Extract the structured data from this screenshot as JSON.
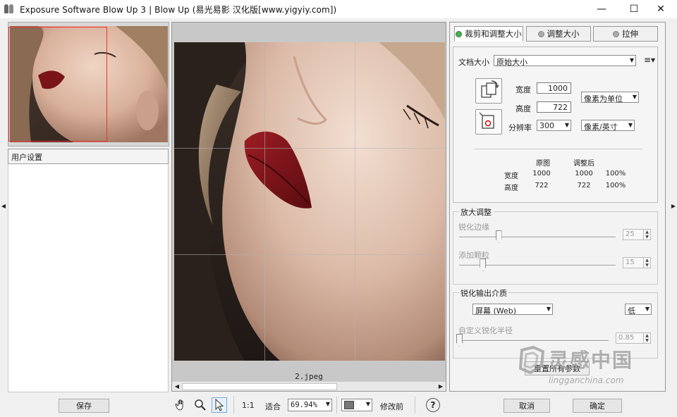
{
  "window": {
    "title": "Exposure Software Blow Up 3 | Blow Up    (易光易影 汉化版[www.yigyiy.com])",
    "minimize": "—",
    "maximize": "☐",
    "close": "✕"
  },
  "left": {
    "preset_header": "用户设置",
    "save_label": "保存"
  },
  "preview": {
    "filename": "2.jpeg"
  },
  "tabs": [
    {
      "label": "裁剪和调整大小",
      "active": true
    },
    {
      "label": "调整大小",
      "active": false
    },
    {
      "label": "拉伸",
      "active": false
    }
  ],
  "doc": {
    "doc_size_label": "文档大小",
    "doc_size_value": "原始大小",
    "width_label": "宽度",
    "width_value": "1000",
    "height_label": "高度",
    "height_value": "722",
    "unit_value": "像素为单位",
    "resolution_label": "分辨率",
    "resolution_value": "300",
    "res_unit_value": "像素/英寸"
  },
  "dimensions": {
    "col_original": "原图",
    "col_adjusted": "调整后",
    "rows": [
      {
        "label": "宽度",
        "original": "1000",
        "adjusted": "1000",
        "percent": "100%"
      },
      {
        "label": "高度",
        "original": "722",
        "adjusted": "722",
        "percent": "100%"
      }
    ]
  },
  "enlarge": {
    "title": "放大调整",
    "sharpen_edges_label": "锐化边缘",
    "sharpen_edges_value": "25",
    "sharpen_edges_level": 0.25,
    "add_grain_label": "添加颗粒",
    "add_grain_value": "15",
    "add_grain_level": 0.15
  },
  "output_sharpen": {
    "title": "锐化输出介质",
    "medium_value": "屏幕 (Web)",
    "amount_value": "低",
    "custom_radius_label": "自定义锐化半径",
    "custom_radius_value": "0.85",
    "custom_radius_level": 0.0
  },
  "reset_label": "重置所有参数",
  "bottom": {
    "zoom_1to1": "1:1",
    "fit_label": "适合",
    "zoom_value": "69.94%",
    "before_after_label": "修改前",
    "cancel_label": "取消",
    "ok_label": "确定",
    "help_icon": "?"
  },
  "watermark": {
    "brand": "灵感中国",
    "url": "lingganchina.com"
  },
  "colors": {
    "accent_green": "#4caf50",
    "crop_frame_red": "#e33333"
  }
}
